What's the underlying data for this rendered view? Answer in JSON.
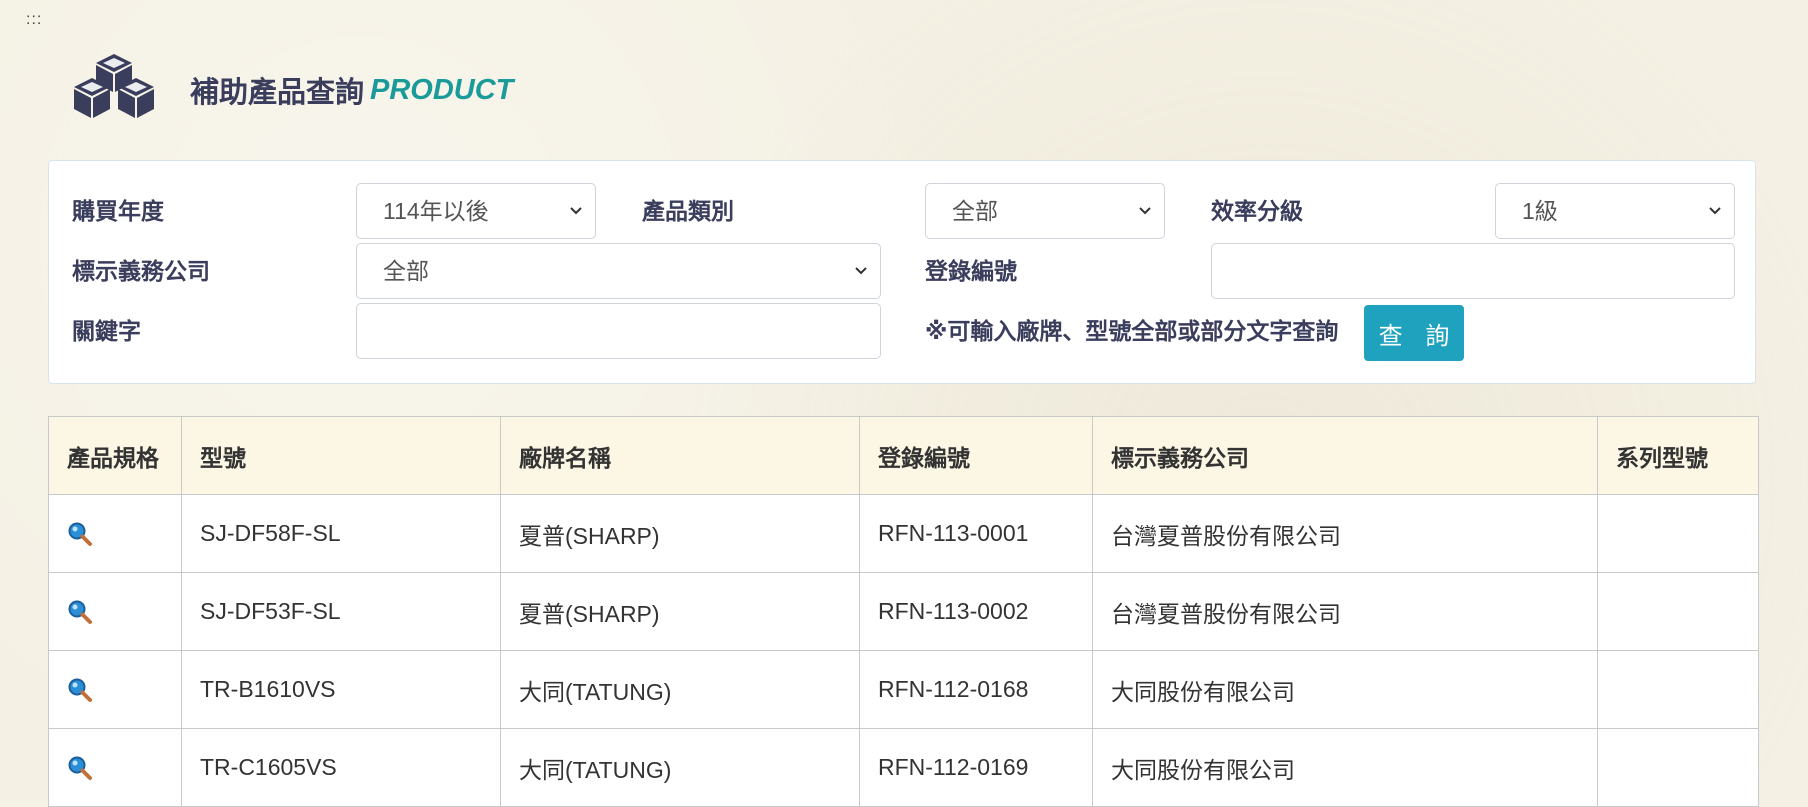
{
  "header": {
    "drag_handle": ":::",
    "title_zh": "補助產品查詢",
    "title_en": "PRODUCT"
  },
  "form": {
    "purchase_year": {
      "label": "購買年度",
      "value": "114年以後"
    },
    "product_category": {
      "label": "產品類別",
      "value": "全部"
    },
    "efficiency_grade": {
      "label": "效率分級",
      "value": "1級"
    },
    "labeling_company": {
      "label": "標示義務公司",
      "value": "全部"
    },
    "registration_no": {
      "label": "登錄編號",
      "value": "",
      "placeholder": ""
    },
    "keyword": {
      "label": "關鍵字",
      "value": "",
      "placeholder": ""
    },
    "hint": "※可輸入廠牌、型號全部或部分文字查詢",
    "query_button": "查 詢"
  },
  "table": {
    "headers": [
      "產品規格",
      "型號",
      "廠牌名稱",
      "登錄編號",
      "標示義務公司",
      "系列型號"
    ],
    "rows": [
      {
        "model": "SJ-DF58F-SL",
        "brand": "夏普(SHARP)",
        "reg_no": "RFN-113-0001",
        "company": "台灣夏普股份有限公司",
        "series": ""
      },
      {
        "model": "SJ-DF53F-SL",
        "brand": "夏普(SHARP)",
        "reg_no": "RFN-113-0002",
        "company": "台灣夏普股份有限公司",
        "series": ""
      },
      {
        "model": "TR-B1610VS",
        "brand": "大同(TATUNG)",
        "reg_no": "RFN-112-0168",
        "company": "大同股份有限公司",
        "series": ""
      },
      {
        "model": "TR-C1605VS",
        "brand": "大同(TATUNG)",
        "reg_no": "RFN-112-0169",
        "company": "大同股份有限公司",
        "series": ""
      }
    ]
  },
  "colors": {
    "accent": "#1fa2bd",
    "title_en": "#1a9a99",
    "header_bg": "#fbf7e4",
    "logo": "#3a3d5c"
  },
  "icons": {
    "logo": "cubes-icon",
    "spec": "magnifier-icon",
    "select": "chevron-down-icon"
  }
}
